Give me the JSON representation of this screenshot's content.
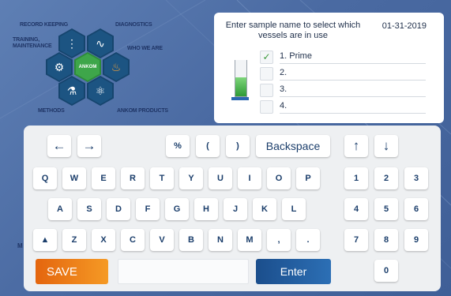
{
  "menu": {
    "record_keeping": "RECORD KEEPING",
    "training": "TRAINING,\nMAINTENANCE",
    "diagnostics": "DIAGNOSTICS",
    "who_we_are": "WHO WE ARE",
    "methods": "METHODS",
    "ankom_products": "ANKOM PRODUCTS",
    "logo_text": "ANKOM",
    "partial_label": "M"
  },
  "panel": {
    "instruction": "Enter sample name to select which vessels are in use",
    "date": "01-31-2019",
    "vessels": [
      {
        "label": "1. Prime",
        "checked": true
      },
      {
        "label": "2.",
        "checked": false
      },
      {
        "label": "3.",
        "checked": false
      },
      {
        "label": "4.",
        "checked": false
      }
    ]
  },
  "keyboard": {
    "top_row": [
      "←",
      "→",
      "%",
      "(",
      ")",
      "Backspace",
      "↑",
      "↓"
    ],
    "row1": [
      "Q",
      "W",
      "E",
      "R",
      "T",
      "Y",
      "U",
      "I",
      "O",
      "P"
    ],
    "row2": [
      "A",
      "S",
      "D",
      "F",
      "G",
      "H",
      "J",
      "K",
      "L"
    ],
    "row3": [
      "▲",
      "Z",
      "X",
      "C",
      "V",
      "B",
      "N",
      "M",
      ",",
      "."
    ],
    "numpad": [
      "1",
      "2",
      "3",
      "4",
      "5",
      "6",
      "7",
      "8",
      "9",
      "0"
    ],
    "save_label": "SAVE",
    "enter_label": "Enter",
    "input_value": ""
  },
  "colors": {
    "save": "#f08a1c",
    "enter": "#1f5a9c",
    "background": "#4d6da5"
  }
}
